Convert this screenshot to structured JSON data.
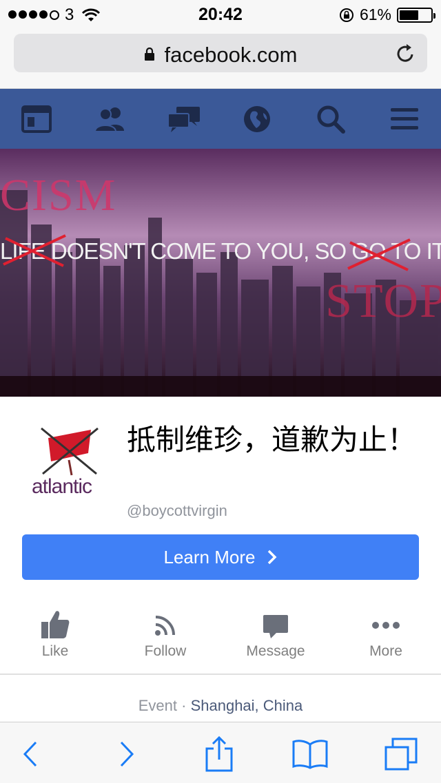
{
  "status_bar": {
    "carrier": "3",
    "time": "20:42",
    "battery": "61%",
    "battery_level": 0.61
  },
  "browser": {
    "url": "facebook.com"
  },
  "fb_nav": {
    "icons": [
      "news-feed-icon",
      "friends-icon",
      "messages-icon",
      "notifications-globe-icon",
      "search-icon",
      "menu-icon"
    ]
  },
  "cover": {
    "red_top": "CISM",
    "slogan": "LIFE DOESN'T COME TO YOU, SO GO TO IT",
    "red_bottom": "STOP"
  },
  "page": {
    "logo_word": "atlantic",
    "title": "抵制维珍，道歉为止！",
    "handle": "@boycottvirgin",
    "learn_more": "Learn More"
  },
  "actions": [
    {
      "label": "Like",
      "icon": "thumbs-up-icon"
    },
    {
      "label": "Follow",
      "icon": "rss-icon"
    },
    {
      "label": "Message",
      "icon": "chat-bubble-icon"
    },
    {
      "label": "More",
      "icon": "ellipsis-icon"
    }
  ],
  "location": {
    "type": "Event",
    "separator": "·",
    "city": "Shanghai, China"
  },
  "colors": {
    "fb_blue": "#3b5998",
    "button_blue": "#4080f6",
    "ios_blue": "#1a7cf6"
  }
}
